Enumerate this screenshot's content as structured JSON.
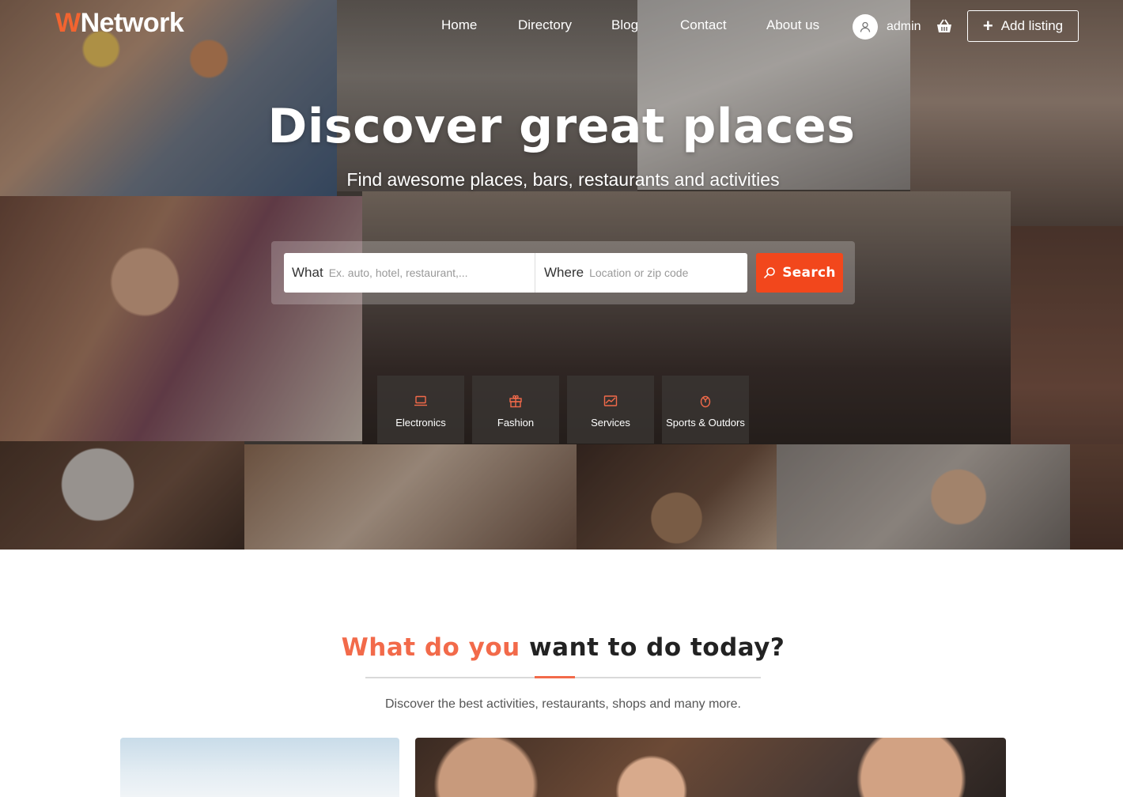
{
  "brand": {
    "logo_accent": "W",
    "logo_rest": "Network",
    "accent_color": "#f26430"
  },
  "nav": {
    "items": [
      {
        "label": "Home"
      },
      {
        "label": "Directory"
      },
      {
        "label": "Blog"
      },
      {
        "label": "Contact"
      },
      {
        "label": "About us"
      }
    ],
    "user_name": "admin",
    "add_listing_label": "Add listing"
  },
  "hero": {
    "title": "Discover great places",
    "subtitle": "Find awesome places, bars, restaurants and activities"
  },
  "search": {
    "what_label": "What",
    "what_placeholder": "Ex. auto, hotel, restaurant,...",
    "where_label": "Where",
    "where_placeholder": "Location or zip code",
    "button_label": "Search",
    "button_color": "#f2471c"
  },
  "categories": [
    {
      "label": "Electronics",
      "icon": "laptop-icon"
    },
    {
      "label": "Fashion",
      "icon": "gift-icon"
    },
    {
      "label": "Services",
      "icon": "chart-icon"
    },
    {
      "label": "Sports & Outdors",
      "icon": "ball-icon"
    }
  ],
  "section": {
    "title_accent": "What do you",
    "title_rest": " want to do today?",
    "subtitle": "Discover the best activities, restaurants, shops and many more."
  }
}
